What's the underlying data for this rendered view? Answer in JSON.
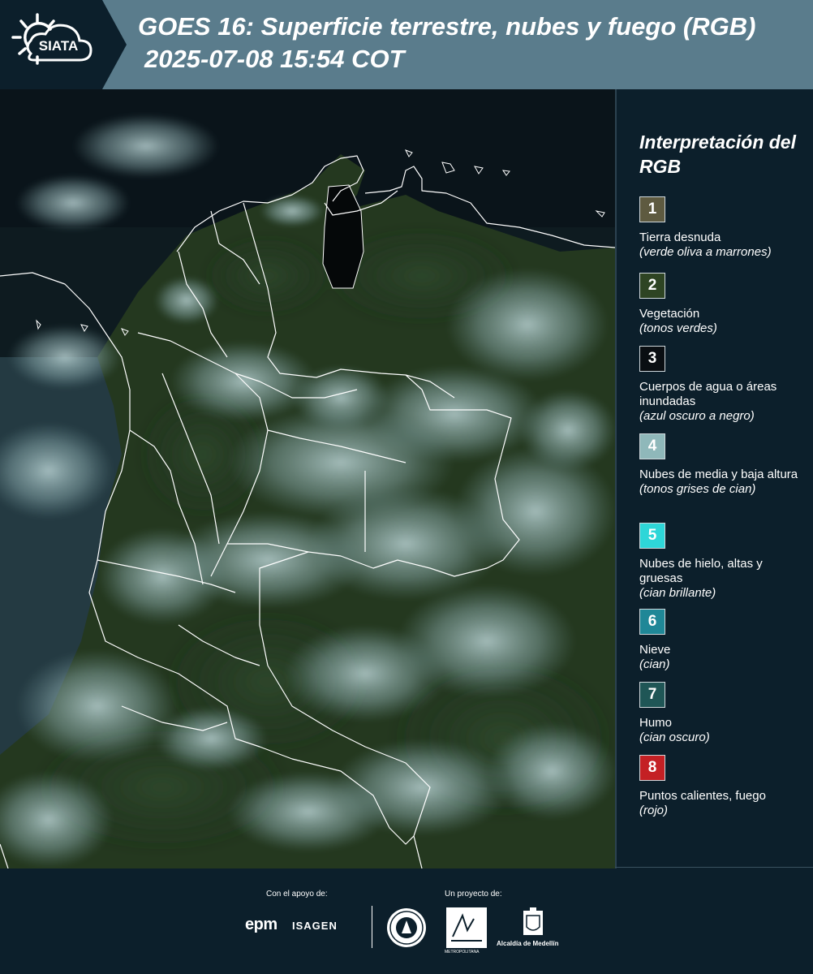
{
  "header": {
    "logo_text": "SIATA",
    "title": "GOES 16: Superficie terrestre, nubes y fuego (RGB)",
    "datetime": "2025-07-08 15:54 COT"
  },
  "legend": {
    "title": "Interpretación del RGB",
    "items": [
      {
        "number": "1",
        "label": "Tierra desnuda",
        "note": "(verde oliva a marrones)",
        "color": "#5e5a40"
      },
      {
        "number": "2",
        "label": "Vegetación",
        "note": "(tonos verdes)",
        "color": "#2e4423"
      },
      {
        "number": "3",
        "label": "Cuerpos de agua o áreas inundadas",
        "note": "(azul oscuro a negro)",
        "color": "#0a0e12"
      },
      {
        "number": "4",
        "label": "Nubes de media y baja altura",
        "note": "(tonos grises de cian)",
        "color": "#8fb8ba"
      },
      {
        "number": "5",
        "label": "Nubes de hielo, altas y gruesas",
        "note": "(cian brillante)",
        "color": "#2ed6d8"
      },
      {
        "number": "6",
        "label": "Nieve",
        "note": "(cian)",
        "color": "#1f8797"
      },
      {
        "number": "7",
        "label": "Humo",
        "note": "(cian oscuro)",
        "color": "#1f5656"
      },
      {
        "number": "8",
        "label": "Puntos calientes, fuego",
        "note": "(rojo)",
        "color": "#c42024"
      }
    ]
  },
  "footer": {
    "support_label": "Con el apoyo de:",
    "project_label": "Un proyecto de:",
    "sponsors": [
      "epm",
      "ISAGEN"
    ],
    "partners": [
      "Área Metropolitana Valle de Aburrá",
      "Alcaldía de Medellín"
    ],
    "amva_text": "METROPOLITANA",
    "medellin_text": "Alcaldía de Medellín"
  }
}
